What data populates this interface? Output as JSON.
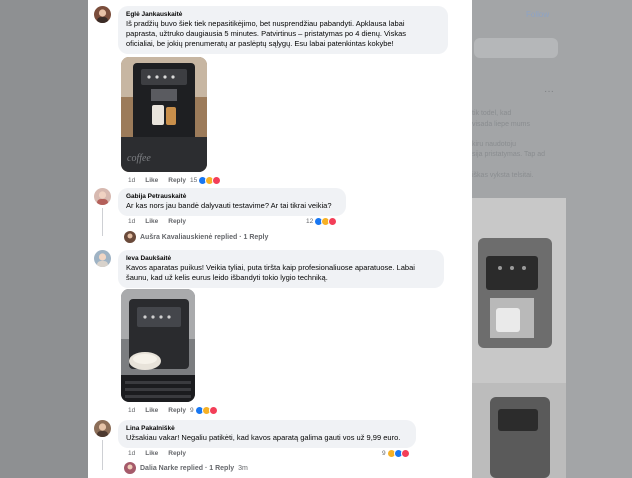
{
  "background": {
    "follow_label": "Follow",
    "more_label": "···",
    "snippets": [
      "tik todel, kad",
      "visada liepe mums",
      "kiru naudotoju",
      "sija pristatymas. Tap ad",
      "iškas vyksta telsitai."
    ]
  },
  "comments": [
    {
      "name": "Eglė Jankauskaitė",
      "lines": [
        "Iš pradžių buvo šiek tiek nepasitikėjimo, bet nusprendžiau pabandyti. Apklausa labai",
        "paprasta, užtruko daugiausia 5 minutes. Patvirtinus – pristatymas po 4 dienų. Viskas",
        "oficialiai, be jokių prenumeratų ar paslėptų sąlygų. Esu labai patenkintas kokybe!"
      ],
      "time": "1d",
      "like": "Like",
      "reply": "Reply",
      "reactions": "15"
    },
    {
      "name": "Gabija Petrauskaitė",
      "lines": [
        "Ar kas nors jau bandė dalyvauti testavime? Ar tai tikrai veikia?"
      ],
      "time": "1d",
      "like": "Like",
      "reply": "Reply",
      "reactions": "12",
      "replied_by": "Aušra Kavaliauskienė replied · 1 Reply"
    },
    {
      "name": "Ieva Daukšaitė",
      "lines": [
        "Kavos aparatas puikus! Veikia tyliai, puta tiršta kaip profesionaliuose aparatuose. Labai",
        "šaunu, kad už kelis eurus leido išbandyti tokio lygio techniką."
      ],
      "time": "1d",
      "like": "Like",
      "reply": "Reply",
      "reactions": "9"
    },
    {
      "name": "Lina Pakalniškė",
      "lines": [
        "Užsakiau vakar! Negaliu patikėti, kad kavos aparatą galima gauti vos už 9,99 euro."
      ],
      "time": "1d",
      "like": "Like",
      "reply": "Reply",
      "reactions": "9",
      "replied_by": "Dalia Narke replied · 1 Reply",
      "replied_time": "3m"
    }
  ]
}
